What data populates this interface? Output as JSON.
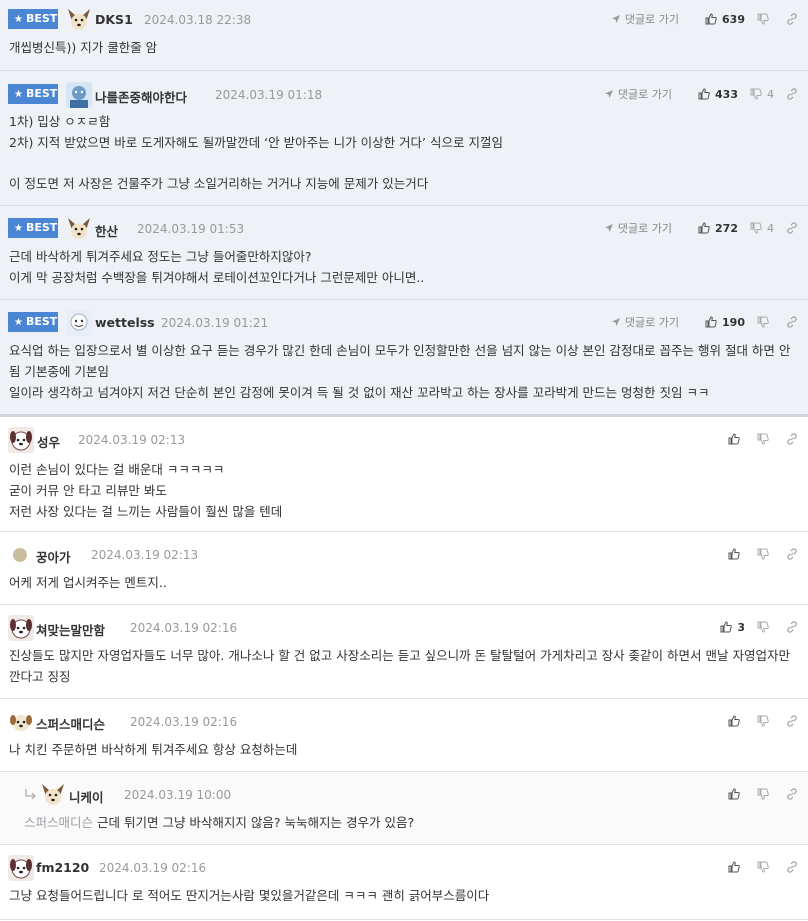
{
  "ui": {
    "best_label": "BEST",
    "goto_label": "댓글로 가기"
  },
  "comments": [
    {
      "best": true,
      "nick": "DKS1",
      "date": "2024.03.18 22:38",
      "likes": "639",
      "dislikes": "",
      "avatar": "dog",
      "lines": [
        "개씹병신특)) 지가 쿨한줄 암"
      ]
    },
    {
      "best": true,
      "nick": "나를존중해야한다",
      "date": "2024.03.19 01:18",
      "likes": "433",
      "dislikes": "4",
      "avatar": "blue",
      "lines": [
        "1차) 밉상 ㅇㅈㄹ함",
        "2차) 지적 받았으면 바로 도게자해도 될까말깐데 ‘안 받아주는 니가 이상한 거다’ 식으로 지껄임",
        "",
        "이 정도면 저 사장은 건물주가 그냥 소일거리하는 거거나 지능에 문제가 있는거다"
      ]
    },
    {
      "best": true,
      "nick": "한산",
      "date": "2024.03.19 01:53",
      "likes": "272",
      "dislikes": "4",
      "avatar": "dog",
      "lines": [
        "근데 바삭하게 튀겨주세요 정도는 그냥 들어줄만하지않아?",
        "이게 막 공장처럼 수백장을 튀겨야해서 로테이션꼬인다거나 그런문제만 아니면.."
      ]
    },
    {
      "best": true,
      "nick": "wettelss",
      "date": "2024.03.19 01:21",
      "likes": "190",
      "dislikes": "",
      "avatar": "face",
      "lines": [
        "요식업 하는 입장으로서 별 이상한 요구 듣는 경우가 많긴 한데 손님이 모두가 인정할만한 선을 넘지 않는 이상 본인 감정대로 꼽주는 행위 절대 하면 안됨 기본중에 기본임",
        "일이라 생각하고 넘겨야지 저건 단순히 본인 감정에 못이겨 득 될 것 없이 재산 꼬라박고 하는 장사를 꼬라박게 만드는 멍청한 짓임 ㅋㅋ"
      ]
    },
    {
      "best": false,
      "nick": "성우",
      "date": "2024.03.19 02:13",
      "likes": "",
      "dislikes": "",
      "avatar": "puppy",
      "lines": [
        "이런 손님이 있다는 걸 배운대 ㅋㅋㅋㅋㅋ",
        "굳이 커뮤 안 타고 리뷰만 봐도",
        "저런 사장 있다는 걸 느끼는 사람들이 훨씬 많을 텐데"
      ]
    },
    {
      "best": false,
      "nick": "꿍아가",
      "date": "2024.03.19 02:13",
      "likes": "",
      "dislikes": "",
      "avatar": "dot",
      "lines": [
        "어케 저게 업시켜주는 멘트지.."
      ]
    },
    {
      "best": false,
      "nick": "쳐맞는말만함",
      "date": "2024.03.19 02:16",
      "likes": "3",
      "dislikes": "",
      "avatar": "puppy",
      "lines": [
        "진상들도 많지만 자영업자들도 너무 많아. 개나소나 할 건 없고 사장소리는 듣고 싶으니까 돈 탈탈털어 가게차리고 장사 좆같이 하면서 맨날 자영업자만 깐다고 징징"
      ]
    },
    {
      "best": false,
      "nick": "스퍼스매디슨",
      "date": "2024.03.19 02:16",
      "likes": "",
      "dislikes": "",
      "avatar": "small",
      "lines": [
        "나 치킨 주문하면 바삭하게 튀겨주세요 항상 요청하는데"
      ]
    },
    {
      "best": false,
      "reply": true,
      "nick": "니케이",
      "date": "2024.03.19 10:00",
      "likes": "",
      "dislikes": "",
      "avatar": "dog",
      "mention": "스퍼스매디슨",
      "lines": [
        "근데 튀기면 그냥 바삭해지지 않음? 눅눅해지는 경우가 있음?"
      ]
    },
    {
      "best": false,
      "nick": "fm2120",
      "date": "2024.03.19 02:16",
      "likes": "",
      "dislikes": "",
      "avatar": "puppy",
      "lines": [
        "그냥 요청들어드립니다 로 적어도 딴지거는사람 몇있을거같은데 ㅋㅋㅋ 괜히 긁어부스름이다"
      ]
    }
  ]
}
